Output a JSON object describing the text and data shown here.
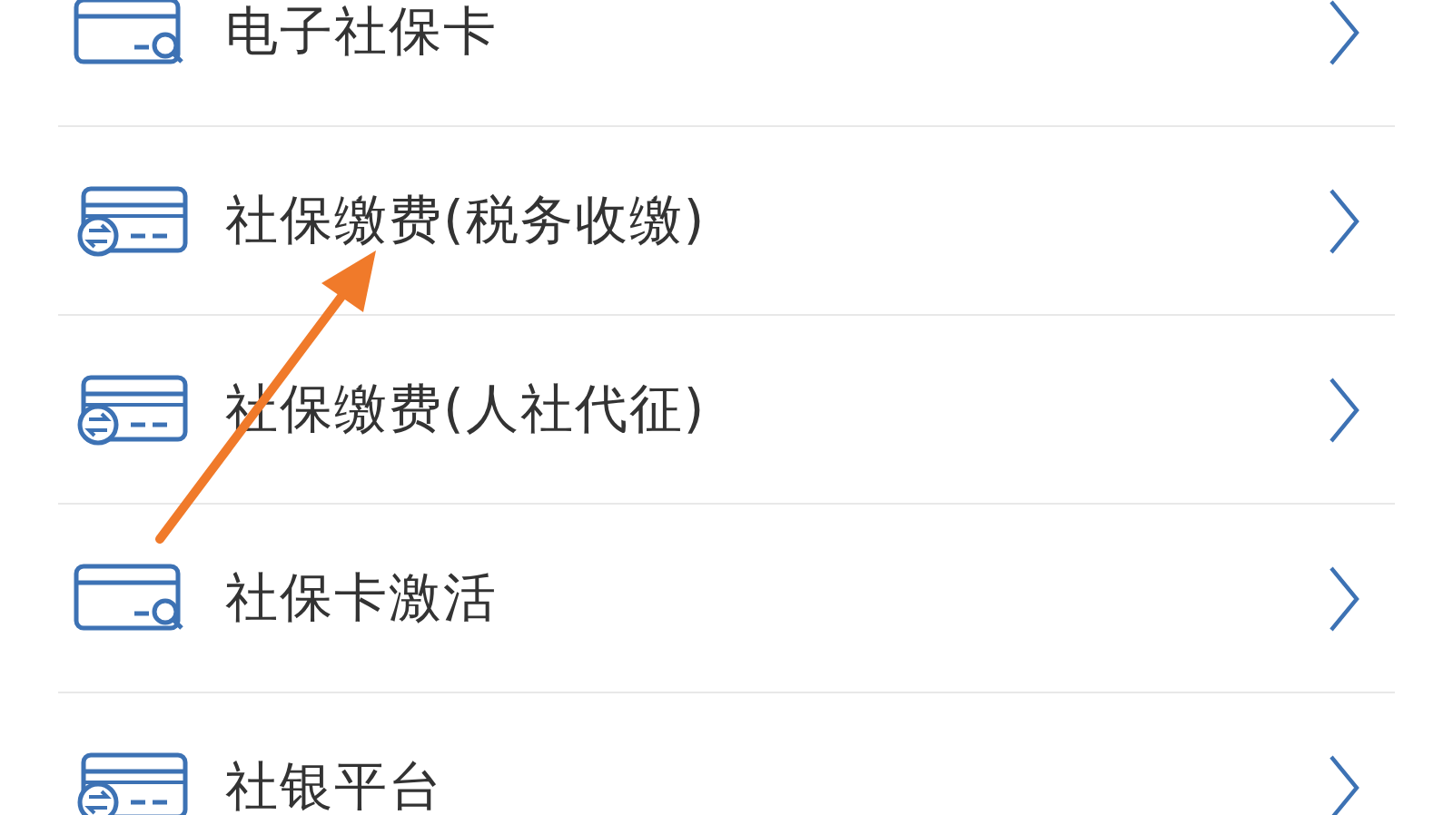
{
  "menu_items": [
    {
      "label": "电子社保卡",
      "kind": "search"
    },
    {
      "label": "社保缴费(税务收缴)",
      "kind": "exchange"
    },
    {
      "label": "社保缴费(人社代征)",
      "kind": "exchange"
    },
    {
      "label": "社保卡激活",
      "kind": "search"
    },
    {
      "label": "社银平台",
      "kind": "exchange"
    }
  ]
}
